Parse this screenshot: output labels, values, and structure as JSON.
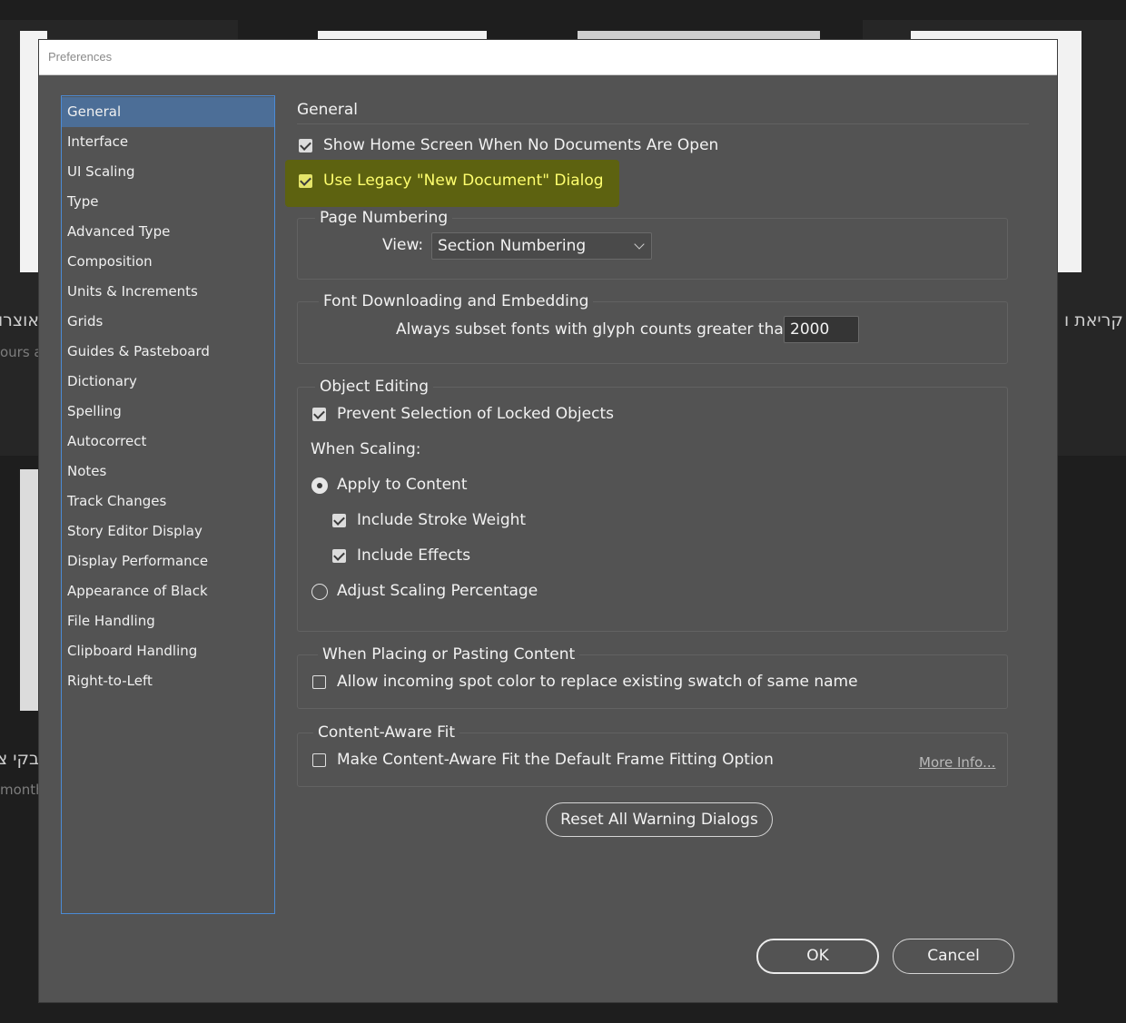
{
  "background": {
    "text_right": "קריאת ו",
    "text_left_1": "אוצרו",
    "sub_left_1": "ours ag",
    "text_left_2": "בקי צ",
    "sub_left_2": "month"
  },
  "dialog": {
    "title": "Preferences",
    "sidebar": [
      "General",
      "Interface",
      "UI Scaling",
      "Type",
      "Advanced Type",
      "Composition",
      "Units & Increments",
      "Grids",
      "Guides & Pasteboard",
      "Dictionary",
      "Spelling",
      "Autocorrect",
      "Notes",
      "Track Changes",
      "Story Editor Display",
      "Display Performance",
      "Appearance of Black",
      "File Handling",
      "Clipboard Handling",
      "Right-to-Left"
    ],
    "selected_index": 0,
    "section_title": "General",
    "show_home_screen": {
      "label": "Show Home Screen When No Documents Are Open",
      "checked": true
    },
    "use_legacy_dialog": {
      "label": "Use Legacy \"New Document\" Dialog",
      "checked": true
    },
    "page_numbering": {
      "label": "Page Numbering",
      "view_label": "View:",
      "view_value": "Section Numbering"
    },
    "font_downloading": {
      "label": "Font Downloading and Embedding",
      "subset_label": "Always subset fonts with glyph counts greater than:",
      "subset_value": "2000"
    },
    "object_editing": {
      "label": "Object Editing",
      "prevent_selection": {
        "label": "Prevent Selection of Locked Objects",
        "checked": true
      },
      "when_scaling": "When Scaling:",
      "apply_to_content": {
        "label": "Apply to Content",
        "selected": true
      },
      "include_stroke_weight": {
        "label": "Include Stroke Weight",
        "checked": true
      },
      "include_effects": {
        "label": "Include Effects",
        "checked": true
      },
      "adjust_scaling": {
        "label": "Adjust Scaling Percentage",
        "selected": false
      }
    },
    "placing_pasting": {
      "label": "When Placing or Pasting Content",
      "allow_spot": {
        "label": "Allow incoming spot color to replace existing swatch of same name",
        "checked": false
      }
    },
    "content_aware_fit": {
      "label": "Content-Aware Fit",
      "make_default": {
        "label": "Make Content-Aware Fit the Default Frame Fitting Option",
        "checked": false
      },
      "more_info": "More Info..."
    },
    "reset_warnings": "Reset All Warning Dialogs",
    "ok": "OK",
    "cancel": "Cancel"
  },
  "colors": {
    "dialog_bg": "#535353",
    "selected_item": "#4c6e97",
    "sidebar_border": "#4b8bd6",
    "highlight": "#5d6210",
    "highlight_text": "#ffff6e"
  }
}
